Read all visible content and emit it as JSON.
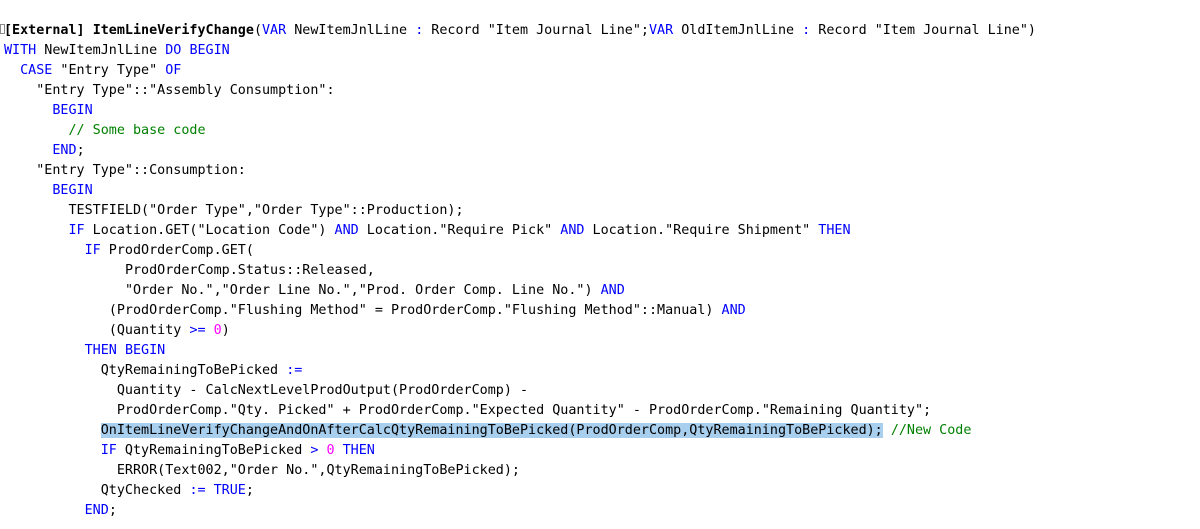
{
  "code": {
    "l1": {
      "external": "[External]",
      "name": "ItemLineVerifyChange",
      "paren": "(",
      "var1": "VAR",
      "p1": " NewItemJnlLine ",
      "colon1": ":",
      "t1": " Record \"Item Journal Line\";",
      "var2": "VAR",
      "p2": " OldItemJnlLine ",
      "colon2": ":",
      "t2": " Record \"Item Journal Line\")"
    },
    "l2": {
      "with": "WITH",
      "obj": " NewItemJnlLine ",
      "do": "DO",
      "sp": " ",
      "begin": "BEGIN"
    },
    "l3": {
      "case": "CASE",
      "expr": " \"Entry Type\" ",
      "of": "OF"
    },
    "l4": {
      "text": "\"Entry Type\"::\"Assembly Consumption\":"
    },
    "l5": {
      "begin": "BEGIN"
    },
    "l6": {
      "comment": "// Some base code"
    },
    "l7": {
      "end": "END",
      "semi": ";"
    },
    "l8": {
      "text": "\"Entry Type\"::Consumption:"
    },
    "l9": {
      "begin": "BEGIN"
    },
    "l10": {
      "text": "TESTFIELD(\"Order Type\",\"Order Type\"::Production);"
    },
    "l11": {
      "if": "IF",
      "a": " Location.GET(\"Location Code\") ",
      "and1": "AND",
      "b": " Location.\"Require Pick\" ",
      "and2": "AND",
      "c": " Location.\"Require Shipment\" ",
      "then": "THEN"
    },
    "l12": {
      "if": "IF",
      "text": " ProdOrderComp.GET("
    },
    "l13": {
      "text": "ProdOrderComp.Status::Released,"
    },
    "l14": {
      "text": "\"Order No.\",\"Order Line No.\",\"Prod. Order Comp. Line No.\") ",
      "and": "AND"
    },
    "l15": {
      "text": "(ProdOrderComp.\"Flushing Method\" = ProdOrderComp.\"Flushing Method\"::Manual) ",
      "and": "AND"
    },
    "l16": {
      "a": "(Quantity ",
      "op": ">=",
      "sp": " ",
      "num": "0",
      "b": ")"
    },
    "l17": {
      "then": "THEN",
      "sp": " ",
      "begin": "BEGIN"
    },
    "l18": {
      "text": "QtyRemainingToBePicked ",
      "op": ":="
    },
    "l19": {
      "text": "Quantity - CalcNextLevelProdOutput(ProdOrderComp) -"
    },
    "l20": {
      "text": "ProdOrderComp.\"Qty. Picked\" + ProdOrderComp.\"Expected Quantity\" - ProdOrderComp.\"Remaining Quantity\";"
    },
    "l21": {
      "highlighted": "OnItemLineVerifyChangeAndOnAfterCalcQtyRemainingToBePicked(ProdOrderComp,QtyRemainingToBePicked);",
      "sp": " ",
      "comment": "//New Code"
    },
    "l22": {
      "if": "IF",
      "a": " QtyRemainingToBePicked ",
      "op": ">",
      "sp": " ",
      "num": "0",
      "sp2": " ",
      "then": "THEN"
    },
    "l23": {
      "text": "ERROR(Text002,\"Order No.\",QtyRemainingToBePicked);"
    },
    "l24": {
      "a": "QtyChecked ",
      "op": ":=",
      "sp": " ",
      "true": "TRUE",
      "semi": ";"
    },
    "l25": {
      "end": "END",
      "semi": ";"
    }
  }
}
